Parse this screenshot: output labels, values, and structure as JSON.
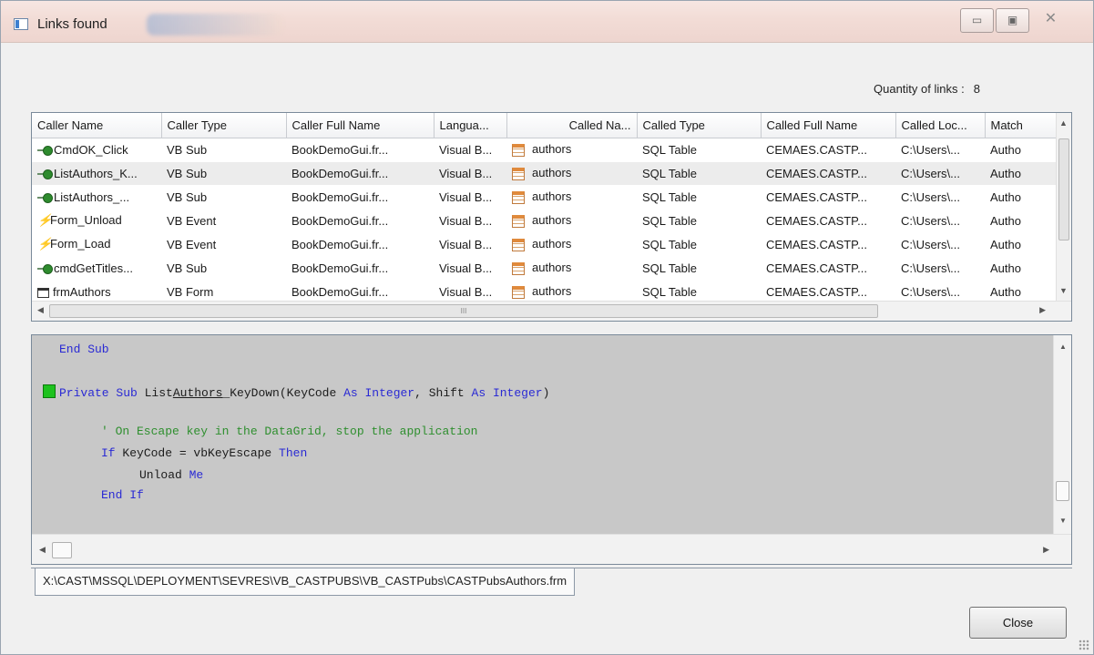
{
  "window": {
    "title": "Links found",
    "min_icon": "▭",
    "max_icon": "▣",
    "close_icon": "✕"
  },
  "summary": {
    "quantity_label": "Quantity of links :",
    "quantity_value": "8"
  },
  "grid": {
    "columns": [
      "Caller Name",
      "Caller Type",
      "Caller Full Name",
      "Langua...",
      "Called Na...",
      "Called Type",
      "Called Full Name",
      "Called Loc...",
      "Match"
    ],
    "rows": [
      {
        "icon": "sub",
        "caller_name": "CmdOK_Click",
        "caller_type": "VB Sub",
        "caller_full": "BookDemoGui.fr...",
        "language": "Visual B...",
        "called_name": "authors",
        "called_type": "SQL Table",
        "called_full": "CEMAES.CASTP...",
        "called_loc": "C:\\Users\\...",
        "match": "Autho"
      },
      {
        "icon": "sub",
        "caller_name": "ListAuthors_K...",
        "caller_type": "VB Sub",
        "caller_full": "BookDemoGui.fr...",
        "language": "Visual B...",
        "called_name": "authors",
        "called_type": "SQL Table",
        "called_full": "CEMAES.CASTP...",
        "called_loc": "C:\\Users\\...",
        "match": "Autho"
      },
      {
        "icon": "sub",
        "caller_name": "ListAuthors_...",
        "caller_type": "VB Sub",
        "caller_full": "BookDemoGui.fr...",
        "language": "Visual B...",
        "called_name": "authors",
        "called_type": "SQL Table",
        "called_full": "CEMAES.CASTP...",
        "called_loc": "C:\\Users\\...",
        "match": "Autho"
      },
      {
        "icon": "event",
        "caller_name": "Form_Unload",
        "caller_type": "VB Event",
        "caller_full": "BookDemoGui.fr...",
        "language": "Visual B...",
        "called_name": "authors",
        "called_type": "SQL Table",
        "called_full": "CEMAES.CASTP...",
        "called_loc": "C:\\Users\\...",
        "match": "Autho"
      },
      {
        "icon": "event",
        "caller_name": "Form_Load",
        "caller_type": "VB Event",
        "caller_full": "BookDemoGui.fr...",
        "language": "Visual B...",
        "called_name": "authors",
        "called_type": "SQL Table",
        "called_full": "CEMAES.CASTP...",
        "called_loc": "C:\\Users\\...",
        "match": "Autho"
      },
      {
        "icon": "sub",
        "caller_name": "cmdGetTitles...",
        "caller_type": "VB Sub",
        "caller_full": "BookDemoGui.fr...",
        "language": "Visual B...",
        "called_name": "authors",
        "called_type": "SQL Table",
        "called_full": "CEMAES.CASTP...",
        "called_loc": "C:\\Users\\...",
        "match": "Autho"
      },
      {
        "icon": "form",
        "caller_name": "frmAuthors",
        "caller_type": "VB Form",
        "caller_full": "BookDemoGui.fr...",
        "language": "Visual B...",
        "called_name": "authors",
        "called_type": "SQL Table",
        "called_full": "CEMAES.CASTP...",
        "called_loc": "C:\\Users\\...",
        "match": "Autho"
      }
    ],
    "hscroll_grip": "III"
  },
  "code": {
    "line1": "End Sub",
    "line2": {
      "kw1": "Private Sub",
      "id_a": " List",
      "id_b": "Authors",
      "id_c": "_KeyDown(KeyCode ",
      "kw2": "As",
      "sp1": " ",
      "kw3": "Integer",
      "id_d": ", Shift ",
      "kw4": "As",
      "sp2": " ",
      "kw5": "Integer",
      "id_e": ")"
    },
    "comment": "' On Escape key in the DataGrid, stop the application",
    "line4": {
      "kw1": "If",
      "id": " KeyCode = vbKeyEscape ",
      "kw2": "Then"
    },
    "line5": {
      "id": "Unload ",
      "kw": "Me"
    },
    "line6": "End If"
  },
  "file_tab": "X:\\CAST\\MSSQL\\DEPLOYMENT\\SEVRES\\VB_CASTPUBS\\VB_CASTPubs\\CASTPubsAuthors.frm",
  "buttons": {
    "close": "Close"
  }
}
